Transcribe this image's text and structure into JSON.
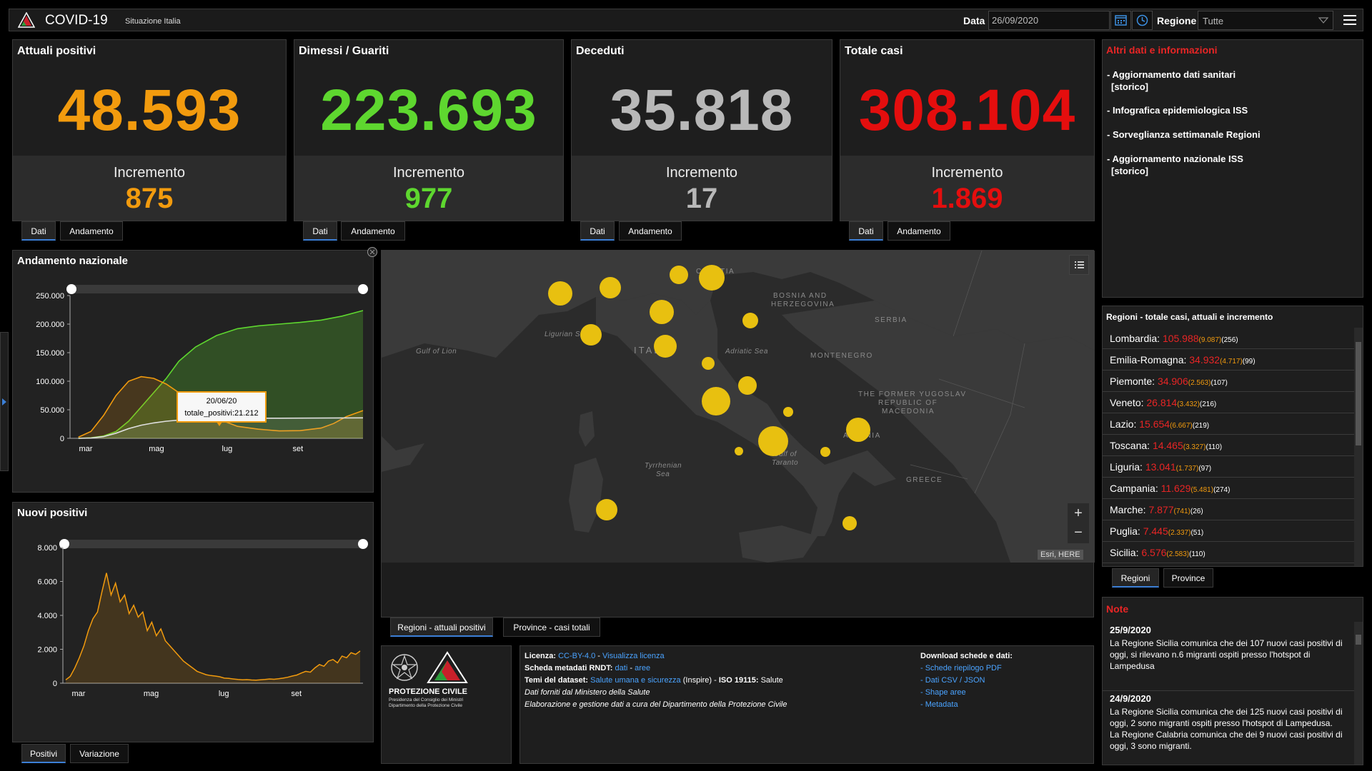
{
  "header": {
    "title": "COVID-19",
    "subtitle": "Situazione Italia",
    "data_label": "Data",
    "date_value": "26/09/2020",
    "regione_label": "Regione",
    "regione_value": "Tutte"
  },
  "cards": [
    {
      "title": "Attuali positivi",
      "value": "48.593",
      "inc_label": "Incremento",
      "inc": "875",
      "color": "#f29b0e"
    },
    {
      "title": "Dimessi / Guariti",
      "value": "223.693",
      "inc_label": "Incremento",
      "inc": "977",
      "color": "#5ed72f"
    },
    {
      "title": "Deceduti",
      "value": "35.818",
      "inc_label": "Incremento",
      "inc": "17",
      "color": "#b8b8b8"
    },
    {
      "title": "Totale casi",
      "value": "308.104",
      "inc_label": "Incremento",
      "inc": "1.869",
      "color": "#e40e0e"
    }
  ],
  "card_tabs": {
    "dati": "Dati",
    "andamento": "Andamento"
  },
  "info": {
    "title": "Altri dati e informazioni",
    "items": [
      {
        "line1": "- Aggiornamento dati sanitari",
        "line2": "[storico]"
      },
      {
        "line1": "- Infografica epidemiologica ISS",
        "line2": ""
      },
      {
        "line1": "- Sorveglianza settimanale Regioni",
        "line2": ""
      },
      {
        "line1": "- Aggiornamento nazionale ISS",
        "line2": "[storico]"
      }
    ]
  },
  "regions": {
    "title": "Regioni - totale casi, attuali e incremento",
    "rows": [
      {
        "name": "Lombardia:",
        "total": "105.988",
        "act": "(9.087)",
        "inc": "(256)"
      },
      {
        "name": "Emilia-Romagna:",
        "total": "34.932",
        "act": "(4.717)",
        "inc": "(99)"
      },
      {
        "name": "Piemonte:",
        "total": "34.906",
        "act": "(2.563)",
        "inc": "(107)"
      },
      {
        "name": "Veneto:",
        "total": "26.814",
        "act": "(3.432)",
        "inc": "(216)"
      },
      {
        "name": "Lazio:",
        "total": "15.654",
        "act": "(6.667)",
        "inc": "(219)"
      },
      {
        "name": "Toscana:",
        "total": "14.465",
        "act": "(3.327)",
        "inc": "(110)"
      },
      {
        "name": "Liguria:",
        "total": "13.041",
        "act": "(1.737)",
        "inc": "(97)"
      },
      {
        "name": "Campania:",
        "total": "11.629",
        "act": "(5.481)",
        "inc": "(274)"
      },
      {
        "name": "Marche:",
        "total": "7.877",
        "act": "(741)",
        "inc": "(26)"
      },
      {
        "name": "Puglia:",
        "total": "7.445",
        "act": "(2.337)",
        "inc": "(51)"
      },
      {
        "name": "Sicilia:",
        "total": "6.576",
        "act": "(2.583)",
        "inc": "(110)"
      }
    ],
    "tab_regioni": "Regioni",
    "tab_province": "Province"
  },
  "notes": {
    "title": "Note",
    "items": [
      {
        "date": "25/9/2020",
        "lines": [
          "La Regione Sicilia comunica che dei 107 nuovi casi positivi di",
          "oggi, si rilevano n.6 migranti ospiti presso l'hotspot di",
          "Lampedusa"
        ]
      },
      {
        "date": "24/9/2020",
        "lines": [
          "La Regione Sicilia comunica che dei 125 nuovi casi positivi di",
          "oggi, 2 sono migranti ospiti presso l'hotspot di Lampedusa.",
          "La Regione Calabria comunica che dei 9 nuovi casi positivi di",
          "oggi, 3 sono migranti."
        ]
      }
    ]
  },
  "trend_chart": {
    "title": "Andamento nazionale",
    "tooltip_date": "20/06/20",
    "tooltip_text": "totale_positivi:21.212",
    "tab_positivi": "Positivi",
    "tab_variazione": "Variazione"
  },
  "new_chart": {
    "title": "Nuovi positivi"
  },
  "chart_data": [
    {
      "type": "line",
      "title": "Andamento nazionale",
      "x_ticks": [
        "mar",
        "mag",
        "lug",
        "set"
      ],
      "y_ticks": [
        "0",
        "50.000",
        "100.000",
        "150.000",
        "200.000",
        "250.000"
      ],
      "ylim": [
        0,
        250000
      ],
      "x_months": [
        1,
        8
      ],
      "series": [
        {
          "color": "#f29b0e",
          "x": [
            1.2,
            1.5,
            1.8,
            2.1,
            2.4,
            2.7,
            3.0,
            3.3,
            3.6,
            4.0,
            4.5,
            5.0,
            5.5,
            6.0,
            6.5,
            7.0,
            7.3,
            7.6,
            8.0
          ],
          "y": [
            2000,
            12000,
            40000,
            75000,
            100000,
            108000,
            105000,
            95000,
            80000,
            55000,
            35000,
            21000,
            16000,
            13000,
            13500,
            18000,
            26000,
            38000,
            48593
          ]
        },
        {
          "color": "#5ed72f",
          "x": [
            1.2,
            1.5,
            1.8,
            2.1,
            2.4,
            2.7,
            3.0,
            3.3,
            3.6,
            4.0,
            4.5,
            5.0,
            5.5,
            6.0,
            6.5,
            7.0,
            7.5,
            8.0
          ],
          "y": [
            0,
            1000,
            4000,
            12000,
            30000,
            55000,
            80000,
            105000,
            135000,
            160000,
            180000,
            192000,
            197000,
            200000,
            203000,
            207000,
            214000,
            223693
          ]
        },
        {
          "color": "#e0e0e0",
          "x": [
            1.2,
            1.5,
            1.8,
            2.1,
            2.4,
            2.7,
            3.0,
            3.3,
            3.6,
            4.0,
            4.5,
            5.0,
            5.5,
            6.0,
            6.5,
            7.0,
            7.5,
            8.0
          ],
          "y": [
            0,
            500,
            3000,
            9000,
            17000,
            23000,
            27000,
            30000,
            32000,
            33500,
            34500,
            35000,
            35100,
            35200,
            35400,
            35500,
            35700,
            35818
          ]
        }
      ]
    },
    {
      "type": "line",
      "title": "Nuovi positivi",
      "x_ticks": [
        "mar",
        "mag",
        "lug",
        "set"
      ],
      "y_ticks": [
        "0",
        "2.000",
        "4.000",
        "6.000",
        "8.000"
      ],
      "ylim": [
        0,
        8000
      ],
      "series": [
        {
          "color": "#f29b0e",
          "values": [
            200,
            400,
            900,
            1500,
            2200,
            3100,
            3800,
            4200,
            5400,
            6500,
            5200,
            5900,
            4800,
            5200,
            4100,
            4600,
            3900,
            4200,
            3100,
            3600,
            2800,
            3200,
            2500,
            2200,
            1900,
            1600,
            1300,
            1100,
            900,
            700,
            600,
            500,
            450,
            420,
            380,
            300,
            280,
            250,
            220,
            200,
            210,
            190,
            180,
            200,
            220,
            250,
            230,
            260,
            300,
            350,
            420,
            480,
            600,
            700,
            650,
            900,
            1100,
            1000,
            1300,
            1400,
            1200,
            1600,
            1500,
            1800,
            1700,
            1900
          ]
        }
      ]
    }
  ],
  "map": {
    "labels": {
      "croatia": "CROATIA",
      "bosnia1": "BOSNIA AND",
      "bosnia2": "HERZEGOVINA",
      "serbia": "SERBIA",
      "montenegro": "MONTENEGRO",
      "macedonia1": "THE FORMER YUGOSLAV",
      "macedonia2": "REPUBLIC OF",
      "macedonia3": "MACEDONIA",
      "albania": "ALBANIA",
      "greece": "GREECE",
      "italy": "ITALY",
      "gulf_lion": "Gulf of Lion",
      "ligurian": "Ligurian Sea",
      "adriatic": "Adriatic Sea",
      "tyrrhenian1": "Tyrrhenian",
      "tyrrhenian2": "Sea",
      "taranto1": "Gulf of",
      "taranto2": "Taranto"
    },
    "attribution": "Esri, HERE",
    "zoom_in": "+",
    "zoom_out": "−",
    "tab_regioni": "Regioni - attuali positivi",
    "tab_province": "Province - casi totali",
    "bubble_color": "#e8c010"
  },
  "footer": {
    "org_line1": "PROTEZIONE CIVILE",
    "org_line2": "Presidenza del Consiglio dei Ministri",
    "org_line3": "Dipartimento della Protezione Civile",
    "licenza_label": "Licenza:",
    "licenza_link": "CC-BY-4.0",
    "licenza_sep": " - ",
    "licenza_view": "Visualizza licenza",
    "scheda_label": "Scheda metadati RNDT:",
    "scheda_dati": "dati",
    "scheda_sep": " - ",
    "scheda_aree": "aree",
    "temi_label": "Temi del dataset:",
    "temi_link": "Salute umana e sicurezza",
    "temi_rest": " (Inspire) - ",
    "iso_label": "ISO 19115:",
    "iso_value": " Salute",
    "fonte": "Dati forniti dal Ministero della Salute",
    "gestione": "Elaborazione e gestione dati a cura del Dipartimento della Protezione Civile",
    "download_title": "Download schede e dati:",
    "download_items": [
      "- Schede riepilogo PDF",
      "- Dati CSV / JSON",
      "- Shape aree",
      "- Metadata"
    ]
  }
}
